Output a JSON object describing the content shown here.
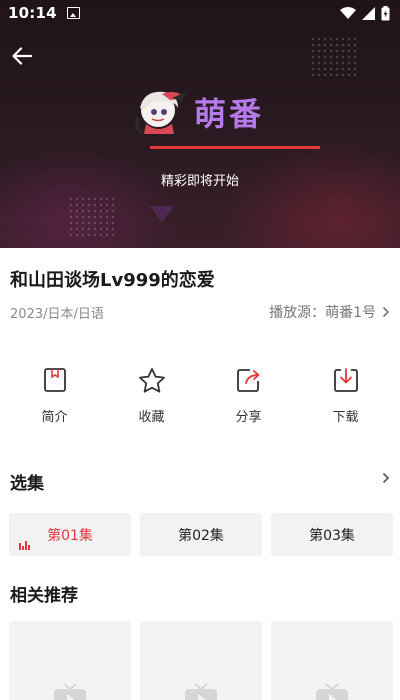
{
  "status_bar": {
    "time": "10:14"
  },
  "player": {
    "logo_text": "萌番",
    "loading_text": "精彩即将开始",
    "progress": 1.0
  },
  "show": {
    "title": "和山田谈场Lv999的恋爱",
    "meta": "2023/日本/日语",
    "source_label": "播放源：萌番1号"
  },
  "actions": [
    {
      "label": "简介",
      "icon": "intro-icon"
    },
    {
      "label": "收藏",
      "icon": "star-icon"
    },
    {
      "label": "分享",
      "icon": "share-icon"
    },
    {
      "label": "下载",
      "icon": "download-icon"
    }
  ],
  "episodes_section": {
    "title": "选集"
  },
  "episodes": [
    {
      "label": "第01集",
      "active": true
    },
    {
      "label": "第02集",
      "active": false
    },
    {
      "label": "第03集",
      "active": false
    }
  ],
  "recommend_section": {
    "title": "相关推荐"
  },
  "colors": {
    "accent": "#e0393e",
    "logo": "#b57ae8",
    "player_bg": "#24161c"
  }
}
